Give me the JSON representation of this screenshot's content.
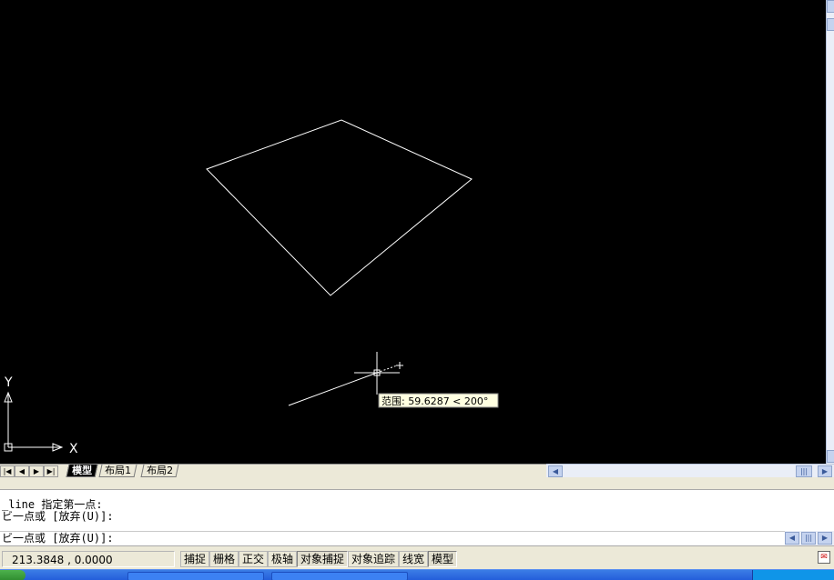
{
  "canvas": {
    "background": "#000000",
    "tooltip": "范围: 59.6287 < 200°",
    "ucs": {
      "x_label": "X",
      "y_label": "Y"
    }
  },
  "layout_tabs": {
    "items": [
      {
        "label": "模型",
        "active": true
      },
      {
        "label": "布局1",
        "active": false
      },
      {
        "label": "布局2",
        "active": false
      }
    ]
  },
  "command": {
    "history": [
      "_line 指定第一点:",
      "ビ一点或 [放弃(U)]:"
    ],
    "prompt": "ビ一点或 [放弃(U)]:"
  },
  "status": {
    "coords": "213.3848 , 0.0000",
    "toggles": [
      {
        "label": "捕捉",
        "on": false
      },
      {
        "label": "栅格",
        "on": false
      },
      {
        "label": "正交",
        "on": false
      },
      {
        "label": "极轴",
        "on": false
      },
      {
        "label": "对象捕捉",
        "on": true
      },
      {
        "label": "对象追踪",
        "on": false
      },
      {
        "label": "线宽",
        "on": false
      },
      {
        "label": "模型",
        "on": true
      }
    ]
  },
  "icons": {
    "nav_first": "first-icon",
    "nav_prev": "prev-icon",
    "nav_next": "next-icon",
    "nav_last": "last-icon",
    "scroll_left": "arrow-left-icon",
    "scroll_right": "arrow-right-icon",
    "scroll_up": "arrow-up-icon",
    "scroll_down": "arrow-down-icon",
    "tray": "communication-center-icon"
  },
  "colors": {
    "drawing_line": "#ffffff",
    "crosshair": "#ffffff",
    "tooltip_bg": "#ffffe1",
    "taskbar": "#245edb"
  }
}
